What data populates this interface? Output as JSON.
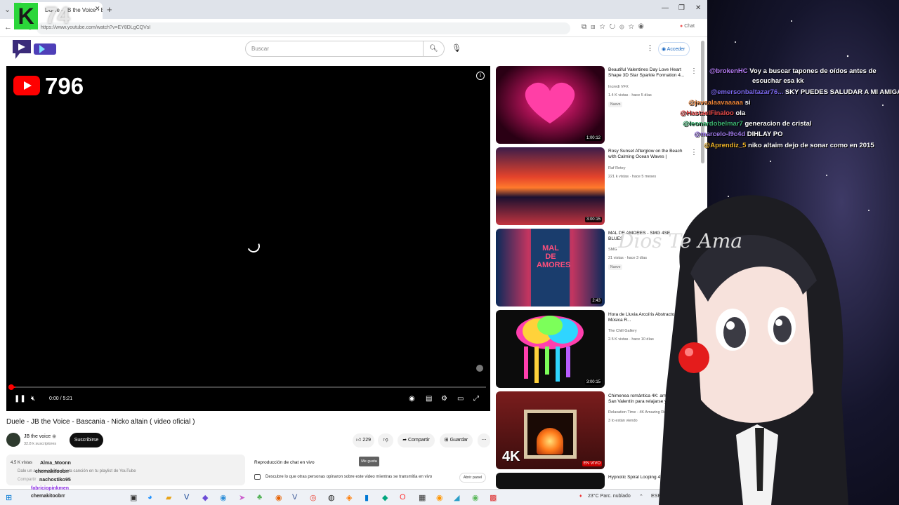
{
  "browser": {
    "tab_title": "Duele - JB the Voice - Bascania - Ni",
    "url": "https://www.youtube.com/watch?v=EY8DLgCQVsI",
    "chat_button": "Chat"
  },
  "overlay": {
    "kick_letter": "K",
    "viewer_count": "74",
    "video_counter": "796",
    "dios_text": "Dios Te Ama"
  },
  "header": {
    "search_placeholder": "Buscar",
    "signin_label": "Acceder"
  },
  "player": {
    "time": "0:00 / 5:21",
    "progress_fraction": 0.01
  },
  "video": {
    "title": "Duele - JB the Voice - Bascania - Nicko altain ( video oficial )",
    "channel": "JB the voice",
    "subscribers": "32.8 k suscriptores",
    "subscribe_label": "Suscribirse",
    "likes": "229",
    "share_label": "Compartir",
    "save_label": "Guardar",
    "tooltip": "Me gusta",
    "views_line": "4.5 K vistas",
    "desc_line2": "Dale un acceso rápido a esta canción en tu playlist de YouTube",
    "desc_line3": "Compartir"
  },
  "livechat": {
    "title": "Reproducción de chat en vivo",
    "desc": "Descubre lo que otras personas opinaron sobre este video mientras se transmitía en vivo",
    "button": "Abrir panel"
  },
  "related": [
    {
      "title": "Beautiful Valentines Day Love Heart Shape 3D Star Sparkle Formation 4...",
      "channel": "Incredi VFX",
      "meta": "1.4 K vistas · hace 5 días",
      "badge": "Nuevo",
      "duration": "1:00:12"
    },
    {
      "title": "Rosy Sunset Afterglow on the Beach with Calming Ocean Waves | Relaxin...",
      "channel": "Raf Retey",
      "meta": "221 k vistas · hace 5 meses",
      "badge": "",
      "duration": "3:00:15"
    },
    {
      "title": "MAL DE AMORES - SMG 4SE BLUES",
      "channel": "SMG",
      "meta": "21 vistas · hace 3 días",
      "badge": "Nuevo",
      "duration": "2:43"
    },
    {
      "title": "Hora de Lluvia Arcoíris Abstractos | Música R...",
      "channel": "The Chill Gallery",
      "meta": "2.5 K vistas · hace 10 días",
      "badge": "",
      "duration": "3:00:15"
    },
    {
      "title": "Chimenea romántica 4K: ambiente San Valentín para relajarse y...",
      "channel": "Relaxation Time - 4K Amazing Relaxing Sc",
      "meta": "3 lo están viendo",
      "badge": "",
      "duration": "EN VIVO"
    },
    {
      "title": "Hypnotic Spiral Looping 4K Free",
      "channel": "",
      "meta": "",
      "badge": "",
      "duration": ""
    }
  ],
  "thumb_overlay": {
    "mal": "MAL DE AMORES",
    "fourk": "4K"
  },
  "chat": [
    {
      "user": "@brokenHC",
      "text": "Voy a buscar tapones de oídos antes de",
      "cont": "escuchar esa kk",
      "color": "#b57cf5"
    },
    {
      "user": "@emersonbaltazar76...",
      "text": "SKY PUEDES SALUDAR A MI AMIGA YULI",
      "color": "#7b68ee"
    },
    {
      "user": "@javaalaavaaaaa",
      "text": "si",
      "color": "#e8823a"
    },
    {
      "user": "@HastaelFinaloo",
      "text": "ola",
      "color": "#e84a4a"
    },
    {
      "user": "@leonardobelmar7",
      "text": "generacion de cristal",
      "color": "#3cb371"
    },
    {
      "user": "@marcelo-l9c4d",
      "text": "DIHLAY PO",
      "color": "#9f7aea"
    },
    {
      "user": "@Aprendiz_5",
      "text": "niko altaim dejo de sonar como en 2015",
      "color": "#f0b429"
    }
  ],
  "bottom_names": [
    "Alma_Moonn",
    "chemakitoobrr",
    "nachostiko95",
    "fabriciopinkmen",
    "chemakitoobrr",
    "Buscar"
  ],
  "taskbar": {
    "weather": "23°C  Parc. nublado",
    "lang": "ESP"
  },
  "colors": {
    "accent": "#ff0000",
    "kick": "#2bd63a",
    "link": "#1565c0"
  }
}
